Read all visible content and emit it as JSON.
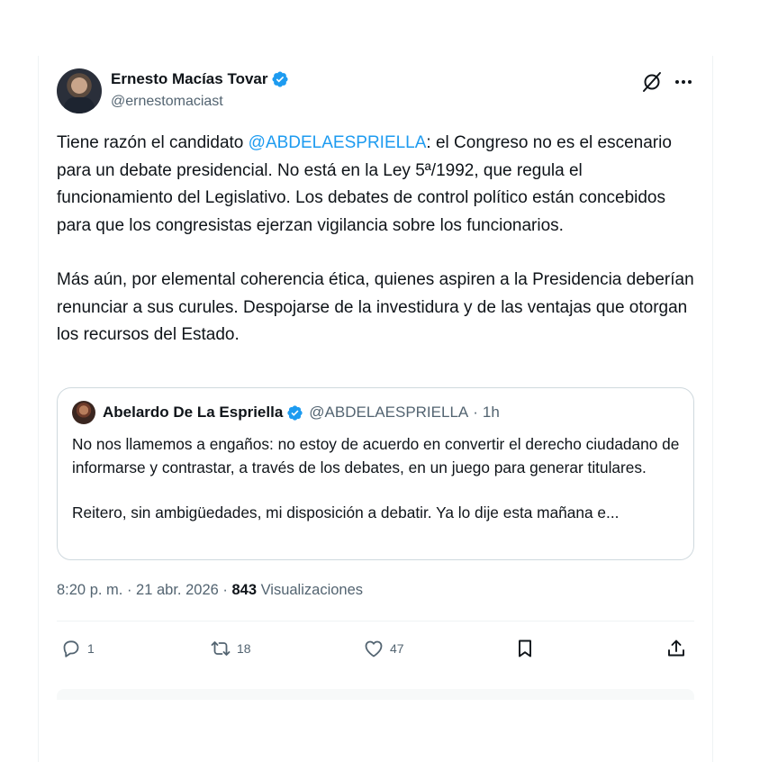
{
  "author": {
    "display_name": "Ernesto Macías Tovar",
    "handle": "@ernestomaciast",
    "verified_icon": "verified-badge-icon"
  },
  "tweet": {
    "paragraph1": {
      "prefix": "Tiene razón el candidato ",
      "mention": "@ABDELAESPRIELLA",
      "suffix": ": el Congreso no es el escenario para un debate presidencial. No está en la Ley 5ª/1992, que regula el funcionamiento del Legislativo. Los debates de control político están concebidos para que los congresistas ejerzan vigilancia sobre los funcionarios."
    },
    "paragraph2": "Más aún, por elemental coherencia ética, quienes aspiren a la Presidencia deberían renunciar a sus curules. Despojarse de la investidura y de las ventajas que otorgan los recursos del Estado."
  },
  "quote": {
    "display_name": "Abelardo De La Espriella",
    "handle": "@ABDELAESPRIELLA",
    "separator": "·",
    "time": "1h",
    "paragraph1": "No nos llamemos a engaños: no estoy de acuerdo en convertir el derecho ciudadano de informarse y contrastar, a través de los debates, en un juego para generar titulares.",
    "paragraph2": "Reitero, sin ambigüedades, mi disposición a debatir. Ya lo dije esta mañana e..."
  },
  "meta": {
    "time": "8:20 p. m.",
    "sep1": " · ",
    "date": "21 abr. 2026",
    "sep2": " · ",
    "views": "843",
    "views_label": " Visualizaciones"
  },
  "actions": {
    "replies": "1",
    "retweets": "18",
    "likes": "47"
  },
  "colors": {
    "accent": "#1d9bf0",
    "text": "#0f1419",
    "secondary": "#536471",
    "border": "#cfd9de"
  }
}
